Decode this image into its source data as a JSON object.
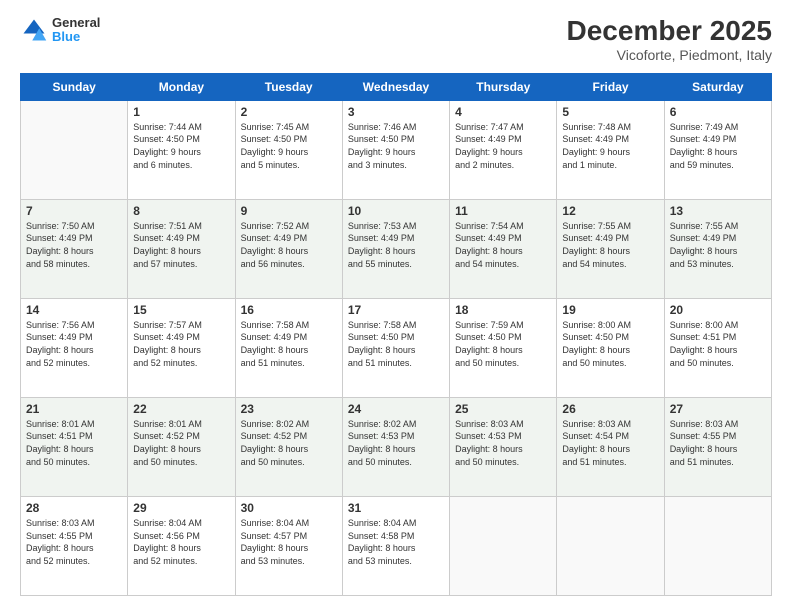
{
  "header": {
    "logo": {
      "line1": "General",
      "line2": "Blue"
    },
    "title": "December 2025",
    "location": "Vicoforte, Piedmont, Italy"
  },
  "weekdays": [
    "Sunday",
    "Monday",
    "Tuesday",
    "Wednesday",
    "Thursday",
    "Friday",
    "Saturday"
  ],
  "rows": [
    [
      {
        "day": "",
        "content": ""
      },
      {
        "day": "1",
        "content": "Sunrise: 7:44 AM\nSunset: 4:50 PM\nDaylight: 9 hours\nand 6 minutes."
      },
      {
        "day": "2",
        "content": "Sunrise: 7:45 AM\nSunset: 4:50 PM\nDaylight: 9 hours\nand 5 minutes."
      },
      {
        "day": "3",
        "content": "Sunrise: 7:46 AM\nSunset: 4:50 PM\nDaylight: 9 hours\nand 3 minutes."
      },
      {
        "day": "4",
        "content": "Sunrise: 7:47 AM\nSunset: 4:49 PM\nDaylight: 9 hours\nand 2 minutes."
      },
      {
        "day": "5",
        "content": "Sunrise: 7:48 AM\nSunset: 4:49 PM\nDaylight: 9 hours\nand 1 minute."
      },
      {
        "day": "6",
        "content": "Sunrise: 7:49 AM\nSunset: 4:49 PM\nDaylight: 8 hours\nand 59 minutes."
      }
    ],
    [
      {
        "day": "7",
        "content": "Sunrise: 7:50 AM\nSunset: 4:49 PM\nDaylight: 8 hours\nand 58 minutes."
      },
      {
        "day": "8",
        "content": "Sunrise: 7:51 AM\nSunset: 4:49 PM\nDaylight: 8 hours\nand 57 minutes."
      },
      {
        "day": "9",
        "content": "Sunrise: 7:52 AM\nSunset: 4:49 PM\nDaylight: 8 hours\nand 56 minutes."
      },
      {
        "day": "10",
        "content": "Sunrise: 7:53 AM\nSunset: 4:49 PM\nDaylight: 8 hours\nand 55 minutes."
      },
      {
        "day": "11",
        "content": "Sunrise: 7:54 AM\nSunset: 4:49 PM\nDaylight: 8 hours\nand 54 minutes."
      },
      {
        "day": "12",
        "content": "Sunrise: 7:55 AM\nSunset: 4:49 PM\nDaylight: 8 hours\nand 54 minutes."
      },
      {
        "day": "13",
        "content": "Sunrise: 7:55 AM\nSunset: 4:49 PM\nDaylight: 8 hours\nand 53 minutes."
      }
    ],
    [
      {
        "day": "14",
        "content": "Sunrise: 7:56 AM\nSunset: 4:49 PM\nDaylight: 8 hours\nand 52 minutes."
      },
      {
        "day": "15",
        "content": "Sunrise: 7:57 AM\nSunset: 4:49 PM\nDaylight: 8 hours\nand 52 minutes."
      },
      {
        "day": "16",
        "content": "Sunrise: 7:58 AM\nSunset: 4:49 PM\nDaylight: 8 hours\nand 51 minutes."
      },
      {
        "day": "17",
        "content": "Sunrise: 7:58 AM\nSunset: 4:50 PM\nDaylight: 8 hours\nand 51 minutes."
      },
      {
        "day": "18",
        "content": "Sunrise: 7:59 AM\nSunset: 4:50 PM\nDaylight: 8 hours\nand 50 minutes."
      },
      {
        "day": "19",
        "content": "Sunrise: 8:00 AM\nSunset: 4:50 PM\nDaylight: 8 hours\nand 50 minutes."
      },
      {
        "day": "20",
        "content": "Sunrise: 8:00 AM\nSunset: 4:51 PM\nDaylight: 8 hours\nand 50 minutes."
      }
    ],
    [
      {
        "day": "21",
        "content": "Sunrise: 8:01 AM\nSunset: 4:51 PM\nDaylight: 8 hours\nand 50 minutes."
      },
      {
        "day": "22",
        "content": "Sunrise: 8:01 AM\nSunset: 4:52 PM\nDaylight: 8 hours\nand 50 minutes."
      },
      {
        "day": "23",
        "content": "Sunrise: 8:02 AM\nSunset: 4:52 PM\nDaylight: 8 hours\nand 50 minutes."
      },
      {
        "day": "24",
        "content": "Sunrise: 8:02 AM\nSunset: 4:53 PM\nDaylight: 8 hours\nand 50 minutes."
      },
      {
        "day": "25",
        "content": "Sunrise: 8:03 AM\nSunset: 4:53 PM\nDaylight: 8 hours\nand 50 minutes."
      },
      {
        "day": "26",
        "content": "Sunrise: 8:03 AM\nSunset: 4:54 PM\nDaylight: 8 hours\nand 51 minutes."
      },
      {
        "day": "27",
        "content": "Sunrise: 8:03 AM\nSunset: 4:55 PM\nDaylight: 8 hours\nand 51 minutes."
      }
    ],
    [
      {
        "day": "28",
        "content": "Sunrise: 8:03 AM\nSunset: 4:55 PM\nDaylight: 8 hours\nand 52 minutes."
      },
      {
        "day": "29",
        "content": "Sunrise: 8:04 AM\nSunset: 4:56 PM\nDaylight: 8 hours\nand 52 minutes."
      },
      {
        "day": "30",
        "content": "Sunrise: 8:04 AM\nSunset: 4:57 PM\nDaylight: 8 hours\nand 53 minutes."
      },
      {
        "day": "31",
        "content": "Sunrise: 8:04 AM\nSunset: 4:58 PM\nDaylight: 8 hours\nand 53 minutes."
      },
      {
        "day": "",
        "content": ""
      },
      {
        "day": "",
        "content": ""
      },
      {
        "day": "",
        "content": ""
      }
    ]
  ]
}
